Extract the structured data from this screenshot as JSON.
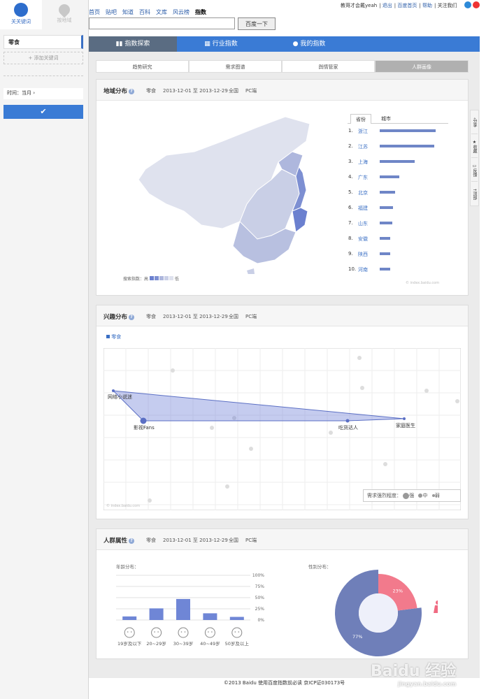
{
  "left": {
    "tab1": "关关键词",
    "tab2": "按地域",
    "keyword": "零食",
    "add_keyword": "+ 添加关键词",
    "time_label": "时间：当月"
  },
  "top": {
    "nav": [
      "首页",
      "贴吧",
      "知道",
      "百科",
      "文库",
      "风云榜",
      "指数"
    ],
    "links": [
      "教哥才会戴yeah",
      "退出",
      "百度首页",
      "帮助",
      "关注我们"
    ],
    "search_button": "百度一下",
    "search_value": ""
  },
  "main_tabs": [
    "指数探索",
    "行业指数",
    "我的指数"
  ],
  "sub_tabs": [
    "趋势研究",
    "需求图谱",
    "舆情管家",
    "人群画像"
  ],
  "region": {
    "title": "地域分布",
    "keyword": "零食",
    "range": "2013-12-01 至 2013-12-29",
    "scope": "全国",
    "device": "PC端",
    "tab_province": "省份",
    "tab_city": "城市",
    "legend_label": "搜索指数：高",
    "legend_low": "低",
    "source": "© index.baidu.com",
    "ranks": [
      {
        "n": "1.",
        "name": "浙江",
        "v": 100
      },
      {
        "n": "2.",
        "name": "江苏",
        "v": 98
      },
      {
        "n": "3.",
        "name": "上海",
        "v": 62
      },
      {
        "n": "4.",
        "name": "广东",
        "v": 35
      },
      {
        "n": "5.",
        "name": "北京",
        "v": 28
      },
      {
        "n": "6.",
        "name": "福建",
        "v": 24
      },
      {
        "n": "7.",
        "name": "山东",
        "v": 23
      },
      {
        "n": "8.",
        "name": "安徽",
        "v": 19
      },
      {
        "n": "9.",
        "name": "陕西",
        "v": 19
      },
      {
        "n": "10.",
        "name": "河南",
        "v": 19
      }
    ]
  },
  "interest": {
    "title": "兴趣分布",
    "keyword": "零食",
    "range": "2013-12-01 至 2013-12-29",
    "scope": "全国",
    "device": "PC端",
    "legend_item": "零食",
    "nodes": [
      "网络小说迷",
      "影视Fans",
      "吃货达人",
      "家庭医生"
    ],
    "strength_label": "需求强烈程度：",
    "strong": "强",
    "mid": "中",
    "weak": "弱",
    "source": "© index.baidu.com"
  },
  "crowd": {
    "title": "人群属性",
    "keyword": "零食",
    "range": "2013-12-01 至 2013-12-29",
    "scope": "全国",
    "device": "PC端",
    "age_title": "年龄分布：",
    "gender_title": "性别分布："
  },
  "chart_data": [
    {
      "type": "bar",
      "title": "年龄分布：",
      "categories": [
        "19岁及以下",
        "20~29岁",
        "30~39岁",
        "40~49岁",
        "50岁及以上"
      ],
      "values": [
        8,
        26,
        47,
        15,
        7
      ],
      "yticks": [
        "100%",
        "75%",
        "50%",
        "25%",
        "0%"
      ],
      "ylim": [
        0,
        100
      ]
    },
    {
      "type": "pie",
      "title": "性别分布：",
      "labels": [
        "男",
        "女"
      ],
      "values": [
        77,
        23
      ],
      "value_labels": [
        "77%",
        "23%"
      ],
      "colors": [
        "#6f7fb9",
        "#f27a8c"
      ]
    }
  ],
  "right_toolbar": [
    "分享",
    "收藏",
    "反馈",
    "顶部"
  ],
  "footer": "©2013 Baidu  使用百度指数前必读  京ICP证030173号",
  "watermark": "Baidu 经验",
  "watermark_url": "jingyan.baidu.com"
}
